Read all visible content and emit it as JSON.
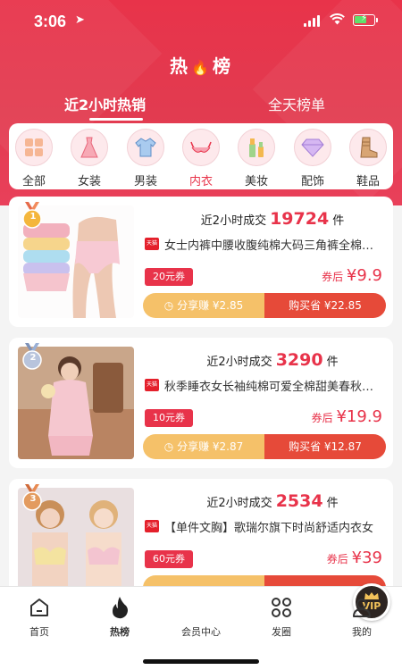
{
  "status": {
    "time": "3:06",
    "location_icon": "location-arrow-icon"
  },
  "header": {
    "title_left": "热",
    "title_right": "榜",
    "title_icon": "flame-icon"
  },
  "tabs": [
    {
      "label": "近2小时热销",
      "active": true
    },
    {
      "label": "全天榜单",
      "active": false
    }
  ],
  "categories": [
    {
      "label": "全部",
      "icon": "grid-icon"
    },
    {
      "label": "女装",
      "icon": "dress-icon"
    },
    {
      "label": "男装",
      "icon": "shirt-icon"
    },
    {
      "label": "内衣",
      "icon": "bra-icon",
      "active": true
    },
    {
      "label": "美妆",
      "icon": "cosmetics-icon"
    },
    {
      "label": "配饰",
      "icon": "diamond-icon"
    },
    {
      "label": "鞋品",
      "icon": "boot-icon"
    }
  ],
  "products": [
    {
      "rank": "1",
      "sales_prefix": "近2小时成交",
      "sales": "19724",
      "sales_unit": "件",
      "mall": "天猫",
      "name": "女士内裤中腰收腹纯棉大码三角裤全棉女士内裤",
      "coupon": "20元券",
      "after_label": "券后",
      "price": "¥9.9",
      "share_label": "分享赚 ¥2.85",
      "buy_label": "购买省 ¥22.85"
    },
    {
      "rank": "2",
      "sales_prefix": "近2小时成交",
      "sales": "3290",
      "sales_unit": "件",
      "mall": "天猫",
      "name": "秋季睡衣女长袖纯棉可爱全棉甜美春秋家居服",
      "coupon": "10元券",
      "after_label": "券后",
      "price": "¥19.9",
      "share_label": "分享赚 ¥2.87",
      "buy_label": "购买省 ¥12.87"
    },
    {
      "rank": "3",
      "sales_prefix": "近2小时成交",
      "sales": "2534",
      "sales_unit": "件",
      "mall": "天猫",
      "name": "【单件文胸】歌瑞尔旗下时尚舒适内衣女",
      "coupon": "60元券",
      "after_label": "券后",
      "price": "¥39",
      "share_label": "",
      "buy_label": ""
    }
  ],
  "nav": [
    {
      "label": "首页",
      "icon": "home-icon"
    },
    {
      "label": "热榜",
      "icon": "flame-icon",
      "active": true
    },
    {
      "label": "会员中心",
      "icon": "vip-crown-icon",
      "badge": "VIP"
    },
    {
      "label": "发圈",
      "icon": "four-circles-icon"
    },
    {
      "label": "我的",
      "icon": "user-icon"
    }
  ],
  "colors": {
    "brand": "#e8334a",
    "share": "#f5c169",
    "buy": "#e64a39"
  }
}
